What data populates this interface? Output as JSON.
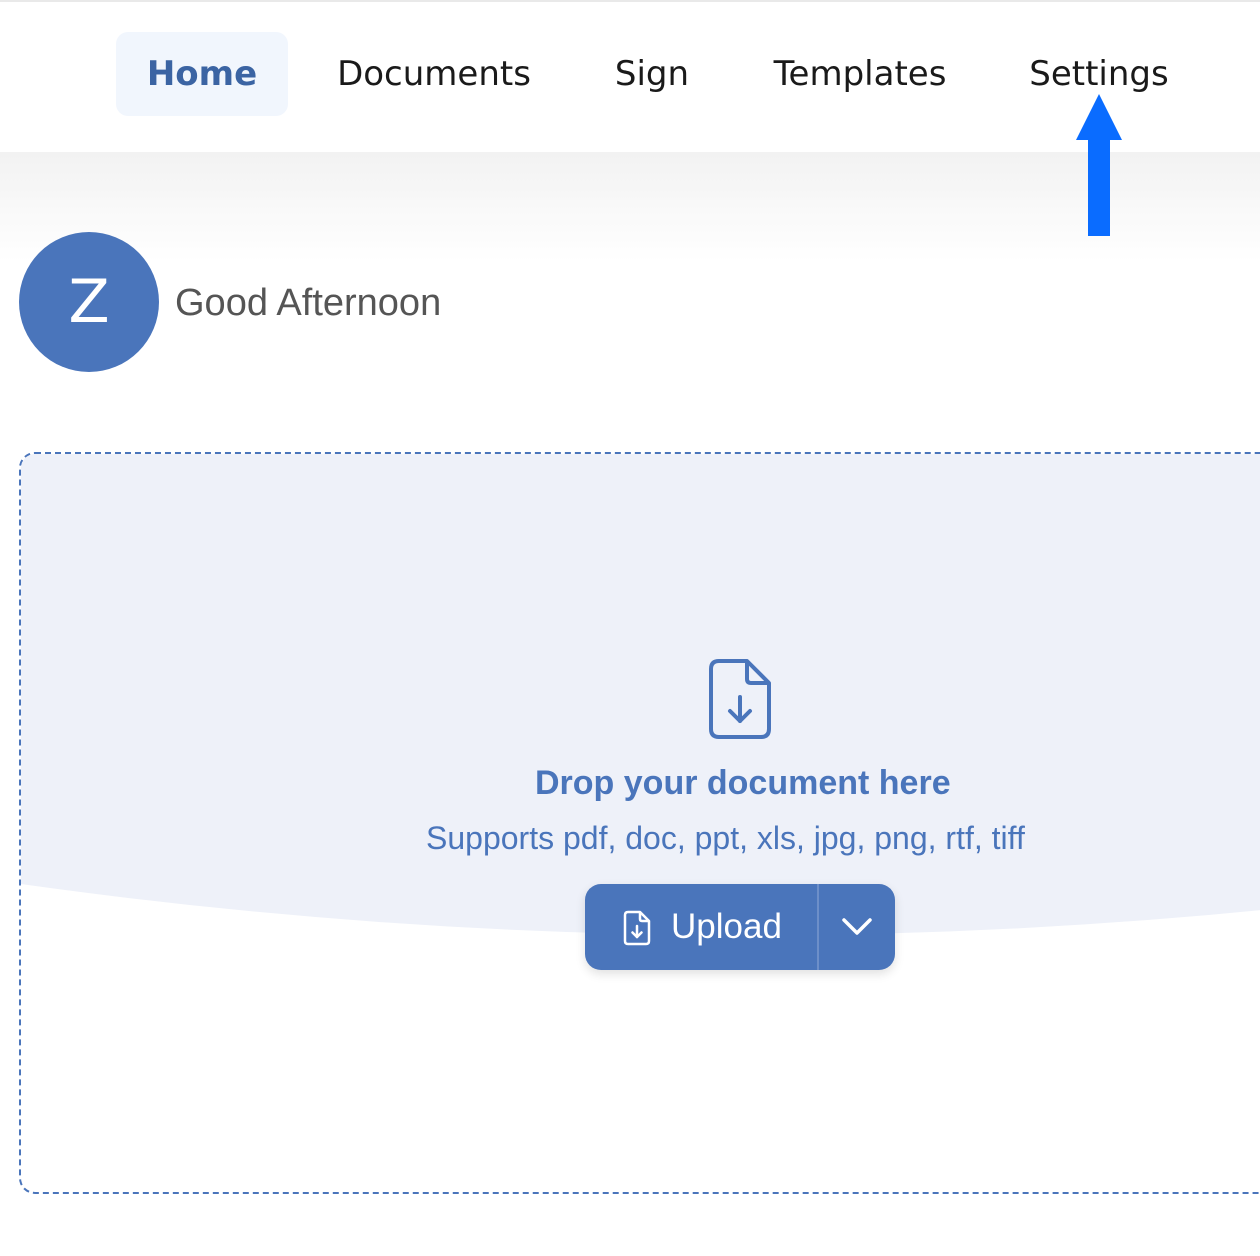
{
  "nav": {
    "home": "Home",
    "documents": "Documents",
    "sign": "Sign",
    "templates": "Templates",
    "settings": "Settings",
    "active": "home"
  },
  "greeting": {
    "avatar_letter": "Z",
    "text": "Good Afternoon"
  },
  "dropzone": {
    "title": "Drop your document here",
    "subtitle": "Supports pdf, doc, ppt, xls, jpg, png, rtf, tiff",
    "icon": "file-download-icon",
    "upload_label": "Upload",
    "upload_icon": "file-download-icon",
    "dropdown_icon": "chevron-down-icon"
  },
  "annotation": {
    "icon": "arrow-up-icon",
    "color": "#0a6cff"
  },
  "colors": {
    "accent": "#4a75bb",
    "active_tab_text": "#3b64a3",
    "active_tab_bg": "#f1f6fd"
  }
}
